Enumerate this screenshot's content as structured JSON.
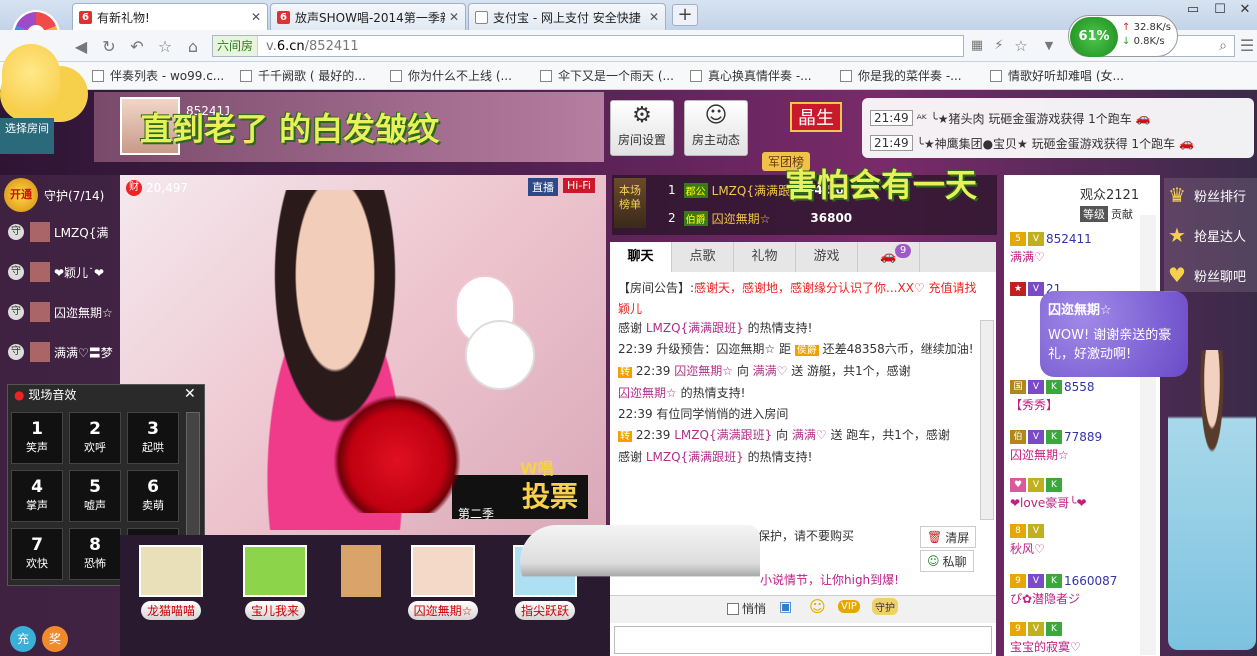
{
  "browser": {
    "tabs": [
      {
        "title": "有新礼物!",
        "favicon_color": "#e03030",
        "active": true
      },
      {
        "title": "放声SHOW唱-2014第一季新秀",
        "favicon_color": "#e03030",
        "active": false
      },
      {
        "title": "支付宝 - 网上支付 安全快捷",
        "favicon_color": "#ffffff",
        "active": false
      }
    ],
    "new_tab": "+",
    "address": {
      "badge": "六间房",
      "prefix": "v.",
      "domain": "6.cn",
      "path": "/852411"
    },
    "speed": {
      "percent": "61%",
      "up": "32.8K/s",
      "down": "0.8K/s"
    },
    "bookmarks": [
      "伴奏列表 - wo99.c...",
      "千千阙歌 ( 最好的...",
      "你为什么不上线 (...",
      "伞下又是一个雨天 (...",
      "真心换真情伴奏 -...",
      "你是我的菜伴奏 -...",
      "情歌好听却难唱 (女..."
    ]
  },
  "sidebar_left": {
    "room_select": "选择房间"
  },
  "header": {
    "banner": "直到老了 的白发皱纹",
    "room_id": "852411",
    "buttons": [
      {
        "label": "房间设置",
        "icon": "gear-icon"
      },
      {
        "label": "房主动态",
        "icon": "person-icon"
      }
    ],
    "level_badge": "晶生",
    "army": "军团榜"
  },
  "gift_feed": [
    {
      "time": "21:49",
      "text": "ᴬᴷ ╰★猪头肉 玩砸金蛋游戏获得 1个跑车"
    },
    {
      "time": "21:49",
      "text": "╰★神鹰集团●宝贝★ 玩砸金蛋游戏获得 1个跑车"
    }
  ],
  "guards": {
    "open": "开通",
    "title": "守护(7/14)",
    "list": [
      "LMZQ{满",
      "❤颖儿˙❤",
      "囚迩無期☆",
      "满满♡〓梦"
    ]
  },
  "video": {
    "viewers_count": "20,497",
    "tag_live": "直播",
    "tag_hifi": "Hi-Fi",
    "ticket_text": "投票",
    "ticket_top": "W唱",
    "ticket_sub": "第二季"
  },
  "sound_panel": {
    "title": "现场音效",
    "buttons": [
      {
        "num": "1",
        "label": "笑声"
      },
      {
        "num": "2",
        "label": "欢呼"
      },
      {
        "num": "3",
        "label": "起哄"
      },
      {
        "num": "4",
        "label": "掌声"
      },
      {
        "num": "5",
        "label": "嘘声"
      },
      {
        "num": "6",
        "label": "卖萌"
      },
      {
        "num": "7",
        "label": "欢快"
      },
      {
        "num": "8",
        "label": "恐怖"
      },
      {
        "num": "9",
        "label": "尖叫"
      }
    ]
  },
  "seats": [
    {
      "name": "龙猫喵喵",
      "color": "#e9dfb8"
    },
    {
      "name": "宝儿我来",
      "color": "#8cd44a"
    },
    {
      "name": "",
      "color": "#d9a46a"
    },
    {
      "name": "囚迩無期☆",
      "color": "#f4d8c8"
    },
    {
      "name": "指尖跃跃",
      "color": "#aee0f4"
    }
  ],
  "recharge": {
    "a": "充",
    "b": "奖"
  },
  "rank": {
    "badge": "本场榜单",
    "rows": [
      {
        "n": "1",
        "title": "郡公",
        "name": "LMZQ{满满跟",
        "value": "54,50"
      },
      {
        "n": "2",
        "title": "伯爵",
        "name": "囚迩無期☆",
        "value": "36800"
      }
    ]
  },
  "watermark": "害怕会有一天",
  "chat": {
    "tabs": [
      "聊天",
      "点歌",
      "礼物",
      "游戏",
      "🚗"
    ],
    "tab_badge": "9",
    "messages": [
      {
        "pre": "【房间公告】:",
        "hl": "感谢天，感谢地，感谢缘分认识了你...XX♡ 充值请找颖儿"
      },
      {
        "pre": "感谢 ",
        "hl": "LMZQ{满满跟班}",
        "post": " 的热情支持!"
      },
      {
        "time": "22:39",
        "pre": "升级预告：囚迩無期☆ 距 ",
        "post": " 还差48358六币，继续加油!"
      },
      {
        "time": "22:39",
        "hl": "囚迩無期☆",
        "pre": " 向 ",
        "hl2": "满满♡",
        "post": " 送 游艇，共1个，感谢"
      },
      {
        "hl": "囚迩無期☆",
        "post": " 的热情支持!"
      },
      {
        "time": "22:39",
        "pre": "有位同学悄悄的进入房间"
      },
      {
        "time": "22:39",
        "hl": "LMZQ{满满跟班}",
        "pre": " 向 ",
        "hl2": "满满♡",
        "post": " 送 跑车，共1个，感谢"
      },
      {
        "pre": "感谢 ",
        "hl": "LMZQ{满满跟班}",
        "post": " 的热情支持!"
      }
    ],
    "notice": "【秀场】私下交易帐号不受保护，请不要购买",
    "promo": "小说情节，让你high到爆!",
    "clear": "清屏",
    "private": "私聊",
    "whisper": "悄悄",
    "vip": "VIP",
    "guard": "守护"
  },
  "viewers": {
    "title": "观众2121",
    "tabs": [
      "等级",
      "贡献"
    ],
    "rows": [
      {
        "name": "852411",
        "extra": "满满♡"
      },
      {
        "name": "21",
        "extra": ""
      },
      {
        "name": "",
        "extra": ""
      },
      {
        "name": "8558",
        "extra": "【秀秀】"
      },
      {
        "name": "77889",
        "extra": "囚迩無期☆"
      },
      {
        "name": "",
        "extra": "❤love豪哥╰❤"
      },
      {
        "name": "",
        "extra": "秋风♡"
      },
      {
        "name": "1660087",
        "extra": "ぴ✿潜隐者ジ"
      },
      {
        "name": "",
        "extra": "宝宝的寂寞♡"
      }
    ],
    "bubble_name": "囚迩無期☆",
    "bubble_text": "WOW! 谢谢亲送的豪礼，好激动啊!"
  },
  "side_menu": [
    {
      "label": "粉丝排行",
      "icon": "crown-icon"
    },
    {
      "label": "抢星达人",
      "icon": "star-icon"
    },
    {
      "label": "粉丝聊吧",
      "icon": "heart-icon"
    }
  ]
}
